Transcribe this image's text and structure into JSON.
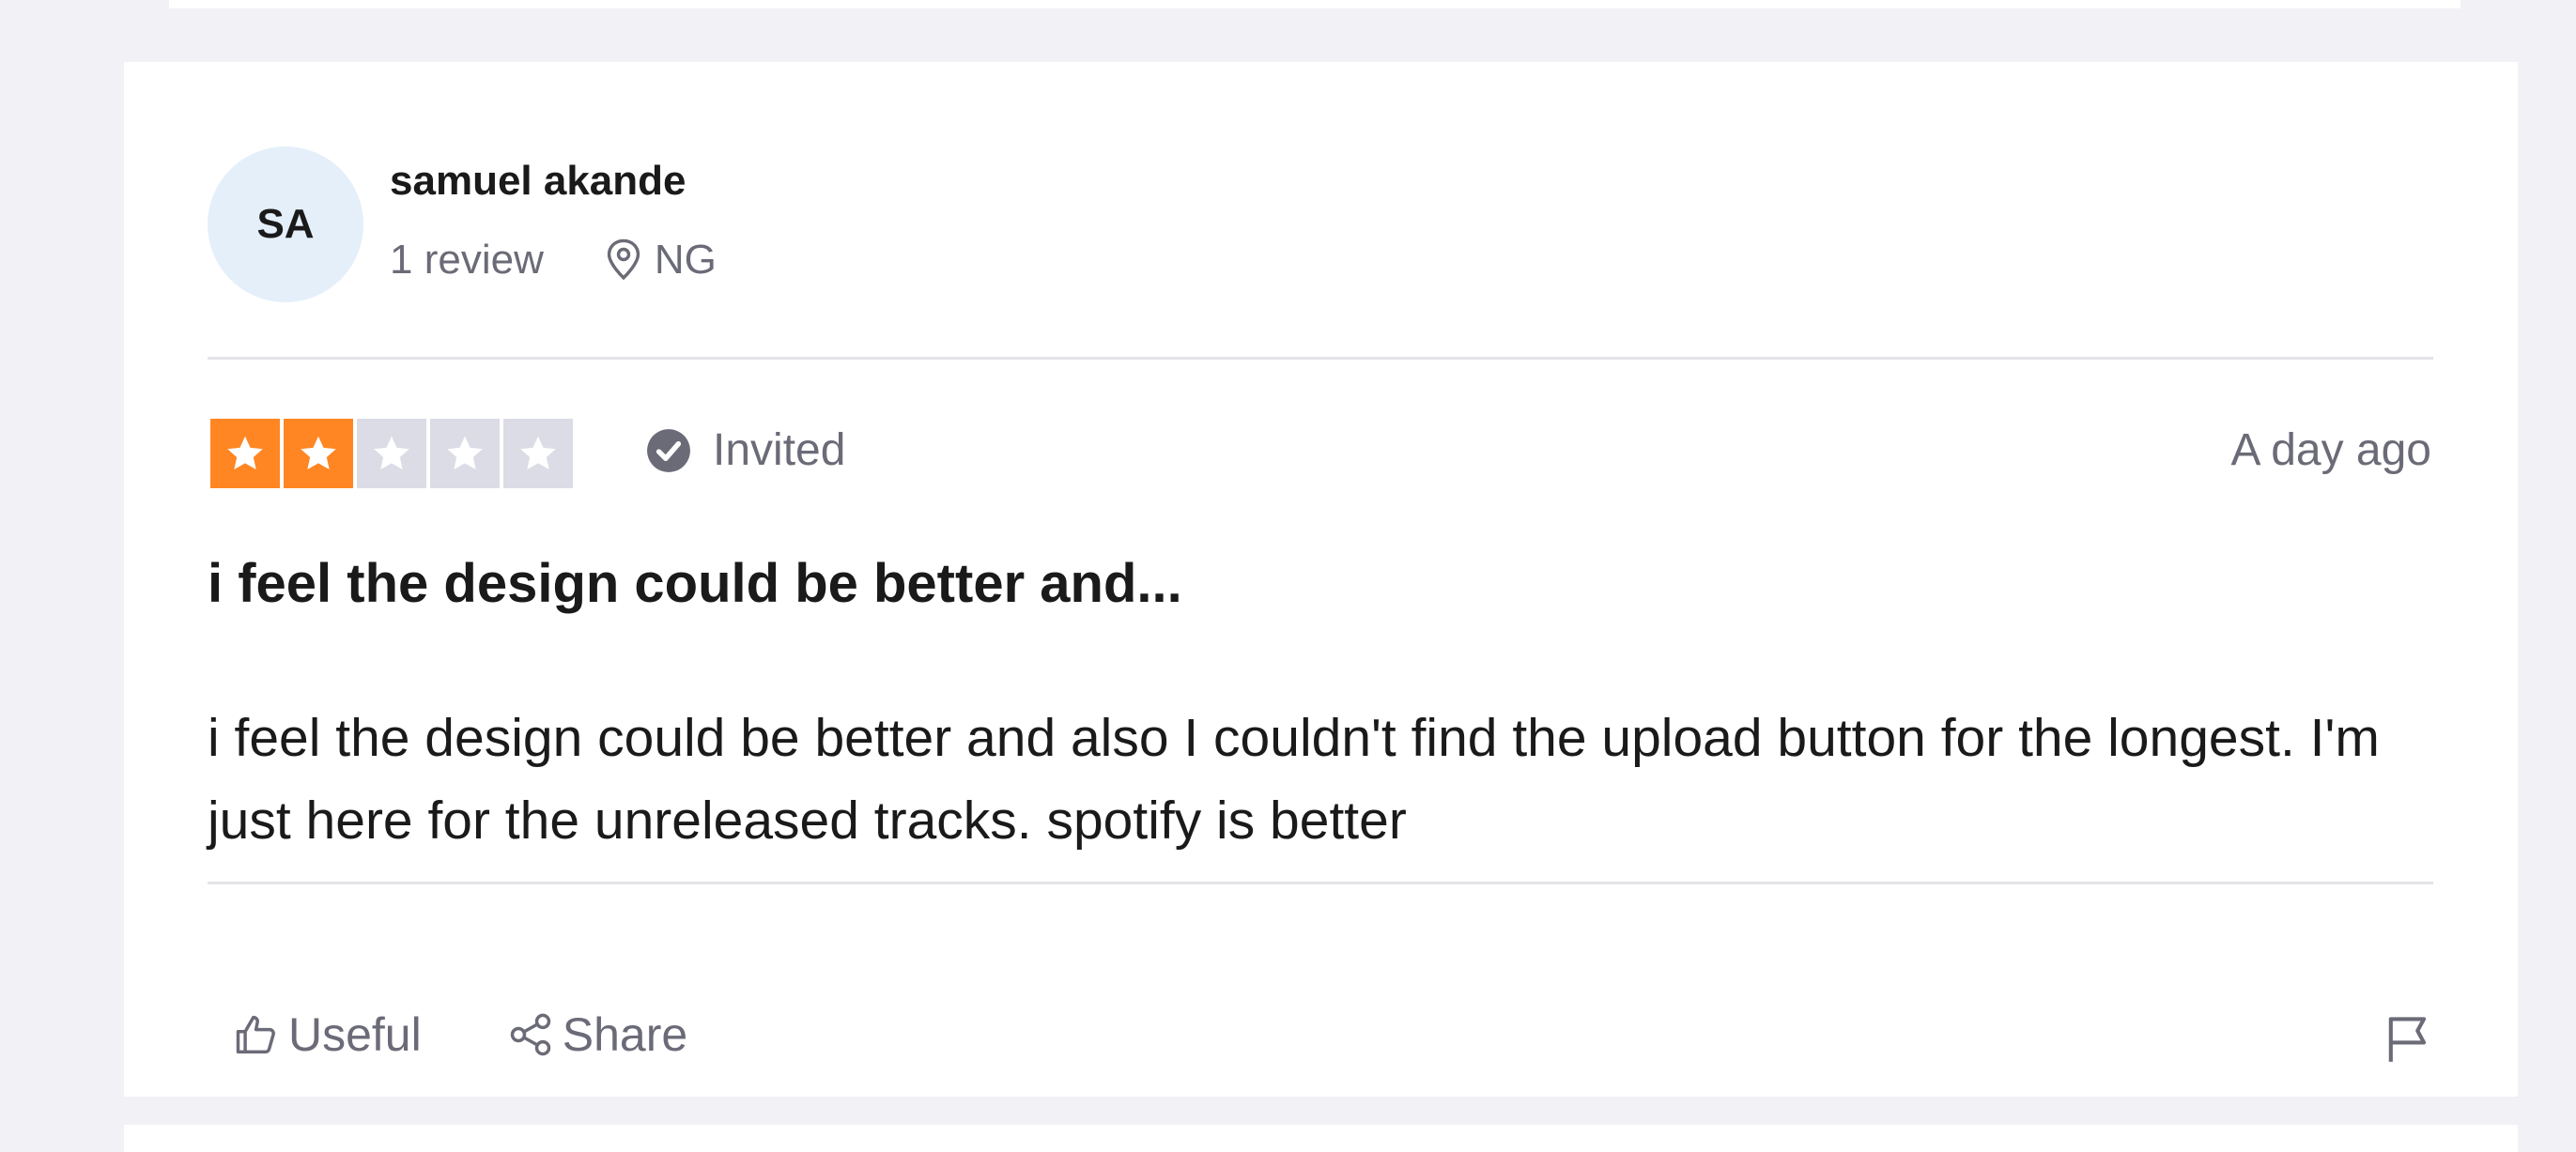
{
  "reviewer": {
    "initials": "SA",
    "name": "samuel akande",
    "review_count": "1 review",
    "location": "NG"
  },
  "review": {
    "rating": 2,
    "rating_max": 5,
    "star_color": "#ff8622",
    "empty_star_color": "#dcdce6",
    "invited_label": "Invited",
    "date": "A day ago",
    "title": "i feel the design could be better and...",
    "body": "i feel the design could be better and also I couldn't find the upload button for the longest. I'm just here for the unreleased tracks. spotify is better"
  },
  "actions": {
    "useful_label": "Useful",
    "share_label": "Share",
    "flag_icon": "flag-icon"
  }
}
